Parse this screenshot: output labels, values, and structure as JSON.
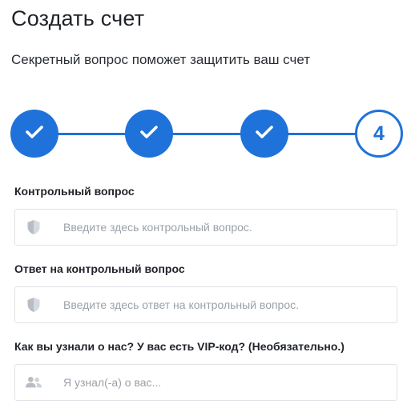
{
  "header": {
    "title": "Создать счет",
    "subtitle": "Секретный вопрос поможет защитить ваш счет"
  },
  "stepper": {
    "steps": [
      {
        "state": "done",
        "icon": "checkmark-icon"
      },
      {
        "state": "done",
        "icon": "checkmark-icon"
      },
      {
        "state": "done",
        "icon": "checkmark-icon"
      },
      {
        "state": "current",
        "number": "4"
      }
    ],
    "accent_color": "#1f72d9"
  },
  "form": {
    "security_question": {
      "label": "Контрольный вопрос",
      "placeholder": "Введите здесь контрольный вопрос.",
      "value": "",
      "icon": "shield-icon"
    },
    "security_answer": {
      "label": "Ответ на контрольный вопрос",
      "placeholder": "Введите здесь ответ на контрольный вопрос.",
      "value": "",
      "icon": "shield-icon"
    },
    "referral": {
      "label": "Как вы узнали о нас? У вас есть VIP-код? (Необязательно.)",
      "placeholder": "Я узнал(-а) о вас...",
      "value": "",
      "icon": "users-icon"
    }
  }
}
